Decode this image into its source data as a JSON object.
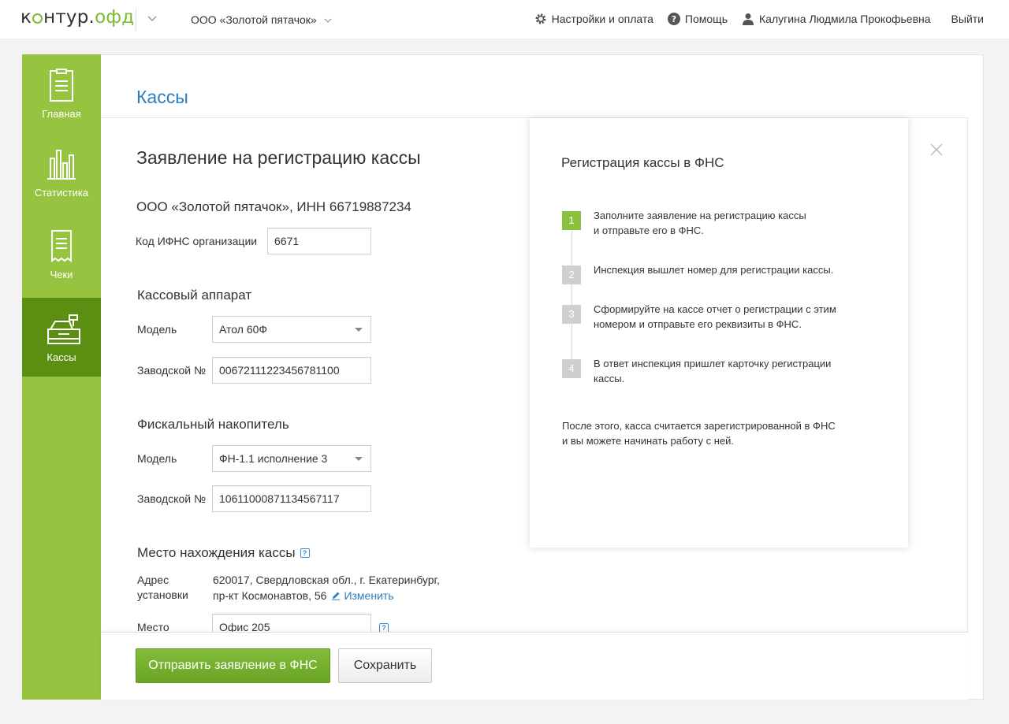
{
  "header": {
    "logo_text_a": "к",
    "logo_text_b": "нтур.",
    "logo_text_ofd": "офд",
    "org_name": "ООО «Золотой пятачок»",
    "settings": "Настройки и оплата",
    "help": "Помощь",
    "user": "Калугина Людмила Прокофьевна",
    "logout": "Выйти"
  },
  "sidebar": {
    "items": [
      {
        "label": "Главная",
        "icon": "document-icon"
      },
      {
        "label": "Статистика",
        "icon": "chart-icon"
      },
      {
        "label": "Чеки",
        "icon": "receipt-icon"
      },
      {
        "label": "Кассы",
        "icon": "cash-register-icon"
      }
    ]
  },
  "page": {
    "title": "Кассы"
  },
  "form": {
    "title": "Заявление на регистрацию кассы",
    "org_inn": "ООО «Золотой пятачок», ИНН 66719887234",
    "ifns_label": "Код ИФНС организации",
    "ifns_value": "6671",
    "register": {
      "heading": "Кассовый аппарат",
      "model_label": "Модель",
      "model_value": "Атол 60Ф",
      "serial_label": "Заводской №",
      "serial_value": "00672111223456781100"
    },
    "fn": {
      "heading": "Фискальный накопитель",
      "model_label": "Модель",
      "model_value": "ФН-1.1 исполнение 3",
      "serial_label": "Заводской №",
      "serial_value": "10611000871134567117"
    },
    "location": {
      "heading": "Место нахождения кассы",
      "help": "?",
      "address_label_1": "Адрес",
      "address_label_2": "установки",
      "address_line_1": "620017, Свердловская обл., г. Екатеринбург,",
      "address_line_2": "пр-кт Космонавтов, 56",
      "change_link": "Изменить",
      "place_label": "Место",
      "place_value": "Офис 205",
      "place_help": "?"
    }
  },
  "info": {
    "title": "Регистрация кассы в ФНС",
    "steps": [
      {
        "num": "1",
        "line1": "Заполните заявление на регистрацию кассы",
        "line2": "и отправьте его в ФНС."
      },
      {
        "num": "2",
        "line1": "Инспекция вышлет номер для регистрации кассы.",
        "line2": ""
      },
      {
        "num": "3",
        "line1": "Сформируйте на кассе отчет о регистрации с этим",
        "line2": "номером и отправьте его реквизиты в ФНС."
      },
      {
        "num": "4",
        "line1": "В ответ инспекция пришлет карточку регистрации",
        "line2": "кассы."
      }
    ],
    "note_line1": "После этого, касса считается зарегистрированной в ФНС",
    "note_line2": "и вы можете начинать работу с ней."
  },
  "footer": {
    "submit": "Отправить заявление в ФНС",
    "save": "Сохранить"
  },
  "colors": {
    "accent_green": "#96c440",
    "active_green": "#5b8f12",
    "link_blue": "#2c7dbd"
  }
}
